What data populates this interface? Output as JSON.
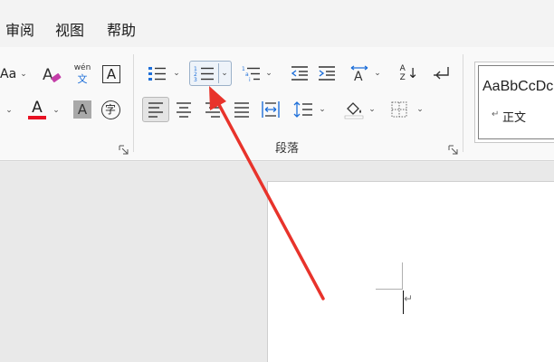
{
  "menu": {
    "review": "审阅",
    "view": "视图",
    "help": "帮助"
  },
  "font_group": {
    "font_size_glyph": "Aa",
    "pinyin_top": "wén",
    "pinyin_bottom": "文",
    "border_char": "A",
    "font_color_char": "A",
    "shade_char": "A",
    "enclose_char": "字"
  },
  "paragraph_group": {
    "label": "段落",
    "sort_top": "A",
    "sort_bottom": "Z"
  },
  "styles": {
    "sample": "AaBbCcDc",
    "name": "正文",
    "para_mark": "↵"
  },
  "document": {
    "para_mark": "↵"
  },
  "colors": {
    "font_color_underline": "#e81123",
    "annotation_arrow": "#e8332b",
    "selected_button_border": "#9bb1c9"
  },
  "annotation": {
    "type": "arrow",
    "points_to": "numbering-button"
  }
}
